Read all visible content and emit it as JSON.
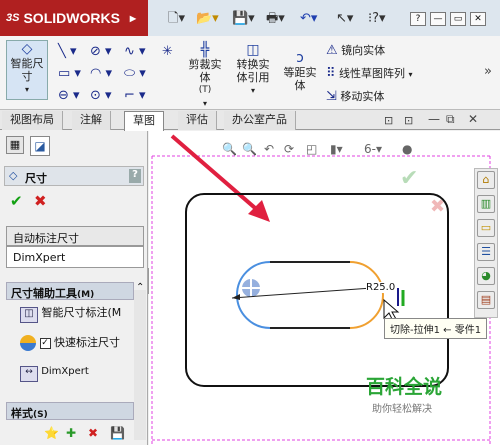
{
  "app": {
    "brand": "SOLIDWORKS",
    "brand_prefix": "3S"
  },
  "window_buttons": {
    "help": "?",
    "minimize": "—",
    "restore": "▭",
    "close": "✕"
  },
  "ribbon": {
    "smart_dimension": "智能尺寸",
    "trim": "剪裁实体",
    "trim_shortcut": "(T)",
    "convert": "转换实体引用",
    "offset": "等距实体",
    "mirror": "镜向实体",
    "linear_pattern": "线性草图阵列",
    "move": "移动实体",
    "more": "»"
  },
  "tabs": [
    "视图布局",
    "注解",
    "草图",
    "评估",
    "办公室产品"
  ],
  "active_tab": "草图",
  "left_panel": {
    "title": "尺寸",
    "help": "?",
    "tab_auto_dim": "自动标注尺寸",
    "tab_dimxpert": "DimXpert",
    "group_tools": "尺寸辅助工具",
    "group_tools_suffix": "(M)",
    "smart_dim_item": "智能尺寸标注",
    "smart_dim_suffix": "(M",
    "quick_dim_item": "快速标注尺寸",
    "dimxpert_item": "DimXpert",
    "group_style": "样式",
    "group_style_suffix": "(S)"
  },
  "canvas": {
    "dimension_label": "R25.0",
    "tooltip": "切除-拉伸1 ← 零件1",
    "confirm": "✔",
    "cancel": "✖"
  },
  "watermark": {
    "title": "百科全说",
    "subtitle": "助你轻松解决"
  },
  "colors": {
    "brand_red": "#b02020",
    "arrow_red": "#e02040",
    "selection_blue": "#4a8fe0",
    "selection_orange": "#f0a030",
    "watermark_green": "#2aa536",
    "frame_magenta": "#e040e0"
  }
}
